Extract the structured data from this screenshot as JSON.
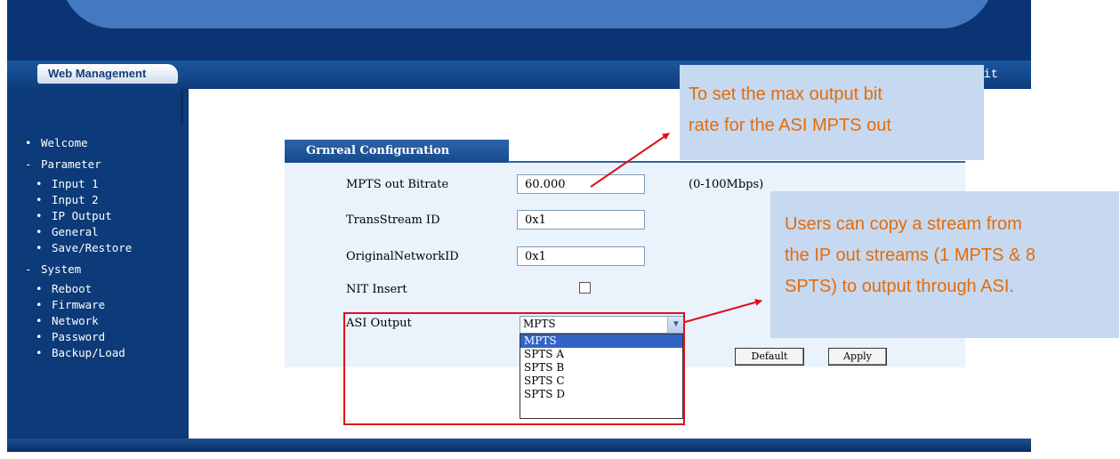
{
  "header": {
    "tab_label": "Web Management",
    "exit_label": "xit"
  },
  "sidebar": {
    "items": [
      {
        "marker": "•",
        "label": "Welcome"
      },
      {
        "marker": "-",
        "label": "Parameter"
      },
      {
        "marker": "•",
        "label": "Input 1"
      },
      {
        "marker": "•",
        "label": "Input 2"
      },
      {
        "marker": "•",
        "label": "IP Output"
      },
      {
        "marker": "•",
        "label": "General"
      },
      {
        "marker": "•",
        "label": "Save/Restore"
      },
      {
        "marker": "-",
        "label": "System"
      },
      {
        "marker": "•",
        "label": "Reboot"
      },
      {
        "marker": "•",
        "label": "Firmware"
      },
      {
        "marker": "•",
        "label": "Network"
      },
      {
        "marker": "•",
        "label": "Password"
      },
      {
        "marker": "•",
        "label": "Backup/Load"
      }
    ]
  },
  "panel": {
    "title": "Grnreal Configuration",
    "fields": {
      "bitrate": {
        "label": "MPTS out Bitrate",
        "value": "60.000",
        "hint": "(0-100Mbps)"
      },
      "tsid": {
        "label": "TransStream ID",
        "value": "0x1"
      },
      "onid": {
        "label": "OriginalNetworkID",
        "value": "0x1"
      },
      "nit": {
        "label": "NIT Insert",
        "checked": false
      },
      "asi": {
        "label": "ASI Output",
        "selected": "MPTS",
        "options": [
          "MPTS",
          "SPTS A",
          "SPTS B",
          "SPTS C",
          "SPTS D"
        ]
      }
    },
    "buttons": {
      "default_label": "Default",
      "apply_label": "Apply"
    }
  },
  "callouts": {
    "bitrate_lines": [
      "To set the max output bit",
      "rate for the ASI MPTS out"
    ],
    "asi_lines": [
      "Users can copy a stream from",
      "the IP out streams (1 MPTS & 8",
      "SPTS) to output through ASI."
    ]
  },
  "colors": {
    "frame_blue": "#0d3a78",
    "panel_bg": "#eaf2fb",
    "callout_bg": "#c6d9f0",
    "callout_text": "#e36c09",
    "annotation_red": "#e0101a"
  }
}
